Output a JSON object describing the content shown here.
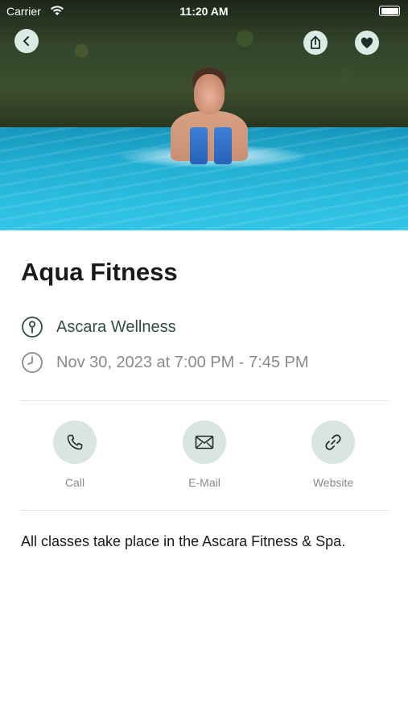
{
  "status_bar": {
    "carrier": "Carrier",
    "time": "11:20 AM"
  },
  "header": {
    "back_icon": "chevron-left-icon",
    "share_icon": "share-icon",
    "favorite_icon": "heart-icon",
    "button_color": "#d9ece4"
  },
  "event": {
    "title": "Aqua Fitness",
    "venue": "Ascara Wellness",
    "datetime": "Nov 30, 2023 at 7:00 PM - 7:45 PM",
    "description": "All classes take place in the Ascara Fitness & Spa."
  },
  "actions": [
    {
      "label": "Call",
      "icon": "phone-icon"
    },
    {
      "label": "E-Mail",
      "icon": "mail-icon"
    },
    {
      "label": "Website",
      "icon": "link-icon"
    }
  ],
  "colors": {
    "accent": "#2f4f3e",
    "bubble": "#d9e6e0",
    "muted_text": "#8a8a8a"
  }
}
